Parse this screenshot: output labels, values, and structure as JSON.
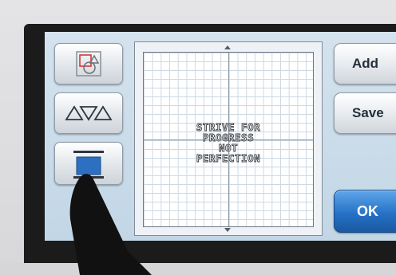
{
  "screen": {
    "left_buttons": [
      {
        "name": "shape-layers-button",
        "icon": "shape-layers-icon"
      },
      {
        "name": "shape-triangles-button",
        "icon": "triangles-icon"
      },
      {
        "name": "alignment-button",
        "icon": "alignment-bar-icon"
      }
    ],
    "right_buttons": {
      "add_label": "Add",
      "save_label": "Save",
      "ok_label": "OK"
    },
    "mat": {
      "text_lines": [
        "STRIVE FOR",
        "PROGRESS",
        "NOT",
        "PERFECTION"
      ]
    },
    "colors": {
      "screen_bg": "#c8dae8",
      "ok_button": "#2672c7",
      "grid_line": "#cdd8e2"
    }
  }
}
